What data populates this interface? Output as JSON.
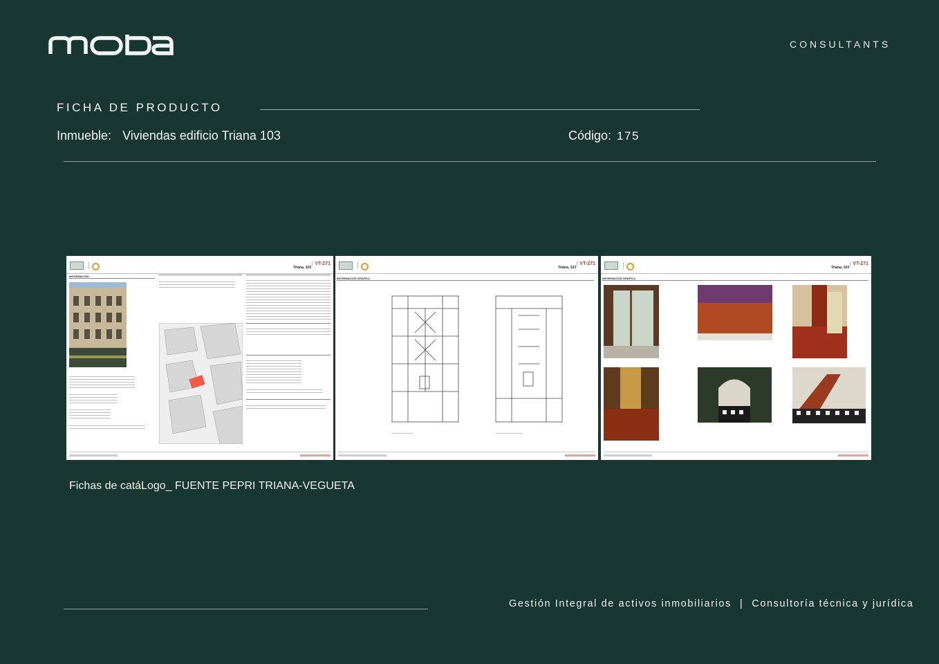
{
  "brand": {
    "logo_text": "moba",
    "tagline": "CONSULTANTS"
  },
  "section": {
    "title": "FICHA DE PRODUCTO"
  },
  "property": {
    "label": "Inmueble:",
    "name": "Viviendas edificio Triana 103",
    "code_label": "Código:",
    "code": "175"
  },
  "sheets": [
    {
      "address": "Triana, 103",
      "code": "VT-271",
      "section": "INFORMACIÓN"
    },
    {
      "address": "Triana, 103",
      "code": "VT-271",
      "section": "INFORMACIÓN GRÁFICA"
    },
    {
      "address": "Triana, 103",
      "code": "VT-271",
      "section": "INFORMACIÓN GRÁFICA"
    }
  ],
  "caption": "Fichas de catáLogo_ FUENTE PEPRI TRIANA-VEGUETA",
  "footer": {
    "left": "Gestión Integral de activos inmobiliarios",
    "separator": "|",
    "right": "Consultoría técnica y jurídica"
  },
  "colors": {
    "background": "#193731",
    "text": "#f1f4f2",
    "accent_red": "#c0392b"
  }
}
